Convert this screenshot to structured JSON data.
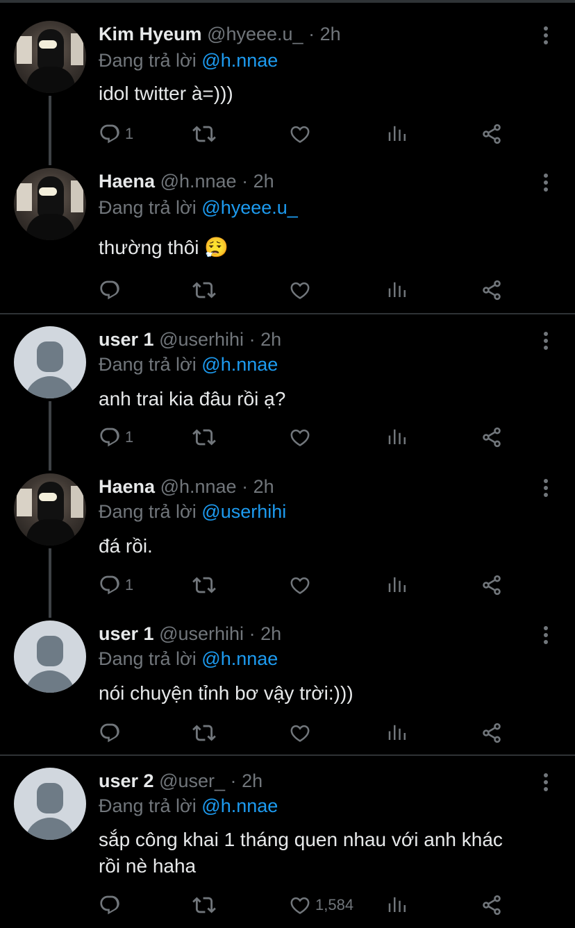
{
  "tweets": [
    {
      "name": "Kim Hyeum",
      "handle": "@hyeee.u_",
      "dot": "·",
      "time": "2h",
      "reply_prefix": "Đang trả lời",
      "reply_to": "@h.nnae",
      "text": "idol twitter à=)))",
      "replies": "1",
      "likes": "",
      "avatar": "photo"
    },
    {
      "name": "Haena",
      "handle": "@h.nnae",
      "dot": "·",
      "time": "2h",
      "reply_prefix": "Đang trả lời",
      "reply_to": "@hyeee.u_",
      "text": "thường thôi 😮‍💨",
      "replies": "",
      "likes": "",
      "avatar": "photo"
    },
    {
      "name": "user 1",
      "handle": "@userhihi",
      "dot": "·",
      "time": "2h",
      "reply_prefix": "Đang trả lời",
      "reply_to": "@h.nnae",
      "text": "anh trai kia đâu rồi ạ?",
      "replies": "1",
      "likes": "",
      "avatar": "default"
    },
    {
      "name": "Haena",
      "handle": "@h.nnae",
      "dot": "·",
      "time": "2h",
      "reply_prefix": "Đang trả lời",
      "reply_to": "@userhihi",
      "text": "đá rồi.",
      "replies": "1",
      "likes": "",
      "avatar": "photo"
    },
    {
      "name": "user 1",
      "handle": "@userhihi",
      "dot": "·",
      "time": "2h",
      "reply_prefix": "Đang trả lời",
      "reply_to": "@h.nnae",
      "text": "nói chuyện tỉnh bơ vậy trời:)))",
      "replies": "",
      "likes": "",
      "avatar": "default"
    },
    {
      "name": "user 2",
      "handle": "@user_",
      "dot": "·",
      "time": "2h",
      "reply_prefix": "Đang trả lời",
      "reply_to": "@h.nnae",
      "text": "sắp công khai 1 tháng quen nhau với anh khác rồi nè haha",
      "replies": "",
      "likes": "1,584",
      "avatar": "default"
    }
  ],
  "icons": {
    "reply": "reply-icon",
    "retweet": "retweet-icon",
    "like": "like-icon",
    "views": "views-icon",
    "share": "share-icon",
    "more": "more-icon"
  },
  "colors": {
    "background": "#000000",
    "text": "#e7e9ea",
    "muted": "#71767b",
    "link": "#1d9bf0",
    "divider": "#2f3336"
  }
}
